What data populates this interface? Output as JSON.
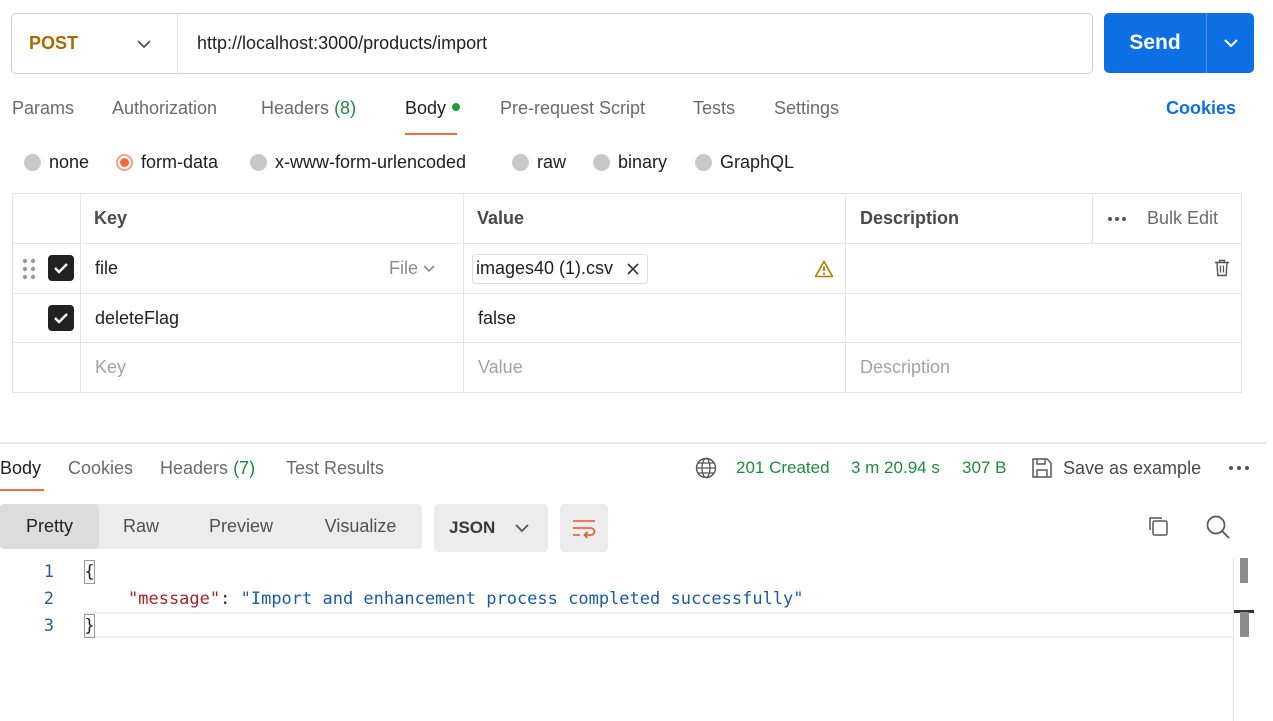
{
  "request": {
    "method": "POST",
    "url": "http://localhost:3000/products/import",
    "send_label": "Send"
  },
  "request_tabs": [
    {
      "label": "Params"
    },
    {
      "label": "Authorization"
    },
    {
      "label": "Headers",
      "count": "(8)"
    },
    {
      "label": "Body"
    },
    {
      "label": "Pre-request Script"
    },
    {
      "label": "Tests"
    },
    {
      "label": "Settings"
    }
  ],
  "cookies_label": "Cookies",
  "body_types": [
    "none",
    "form-data",
    "x-www-form-urlencoded",
    "raw",
    "binary",
    "GraphQL"
  ],
  "body_type_selected": "form-data",
  "params_table": {
    "headers": {
      "key": "Key",
      "value": "Value",
      "description": "Description",
      "bulk_edit": "Bulk Edit"
    },
    "rows": [
      {
        "key": "file",
        "type": "File",
        "value": "images40 (1).csv",
        "checked": true
      },
      {
        "key": "deleteFlag",
        "value": "false",
        "checked": true
      }
    ],
    "placeholders": {
      "key": "Key",
      "value": "Value",
      "description": "Description"
    }
  },
  "response_tabs": [
    {
      "label": "Body"
    },
    {
      "label": "Cookies"
    },
    {
      "label": "Headers",
      "count": "(7)"
    },
    {
      "label": "Test Results"
    }
  ],
  "response_meta": {
    "status": "201 Created",
    "time": "3 m 20.94 s",
    "size": "307 B",
    "save_label": "Save as example"
  },
  "format_tabs": [
    "Pretty",
    "Raw",
    "Preview",
    "Visualize"
  ],
  "format_selected": "Pretty",
  "language": "JSON",
  "code_lines": [
    {
      "n": "1",
      "text": "{"
    },
    {
      "n": "2",
      "key": "\"message\"",
      "sep": ": ",
      "value": "\"Import and enhancement process completed successfully\""
    },
    {
      "n": "3",
      "text": "}"
    }
  ],
  "colors": {
    "accent": "#f26b3a",
    "send": "#0c6fe3",
    "method": "#a46b00",
    "status_green": "#1e8a3c"
  }
}
